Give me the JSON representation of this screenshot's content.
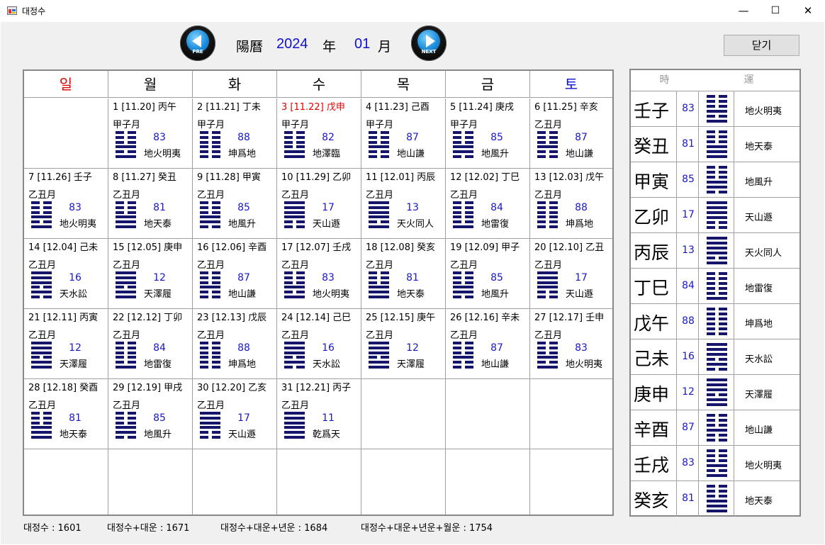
{
  "window": {
    "title": "대정수",
    "minimize": "—",
    "maximize": "☐",
    "close": "✕",
    "icon": "app-window-icon"
  },
  "nav": {
    "pre_caption": "PRE",
    "next_caption": "NEXT",
    "calendar_label": "陽曆",
    "year": "2024",
    "year_label": "年",
    "month": "01",
    "month_label": "月"
  },
  "close_button_label": "닫기",
  "colors": {
    "hex_bar": "#15156b",
    "number_blue": "#1818c8",
    "sunday": "#e00000",
    "saturday": "#1010d0"
  },
  "weekdays": [
    {
      "label": "일",
      "color": "#e00000"
    },
    {
      "label": "월",
      "color": "#000000"
    },
    {
      "label": "화",
      "color": "#000000"
    },
    {
      "label": "수",
      "color": "#000000"
    },
    {
      "label": "목",
      "color": "#000000"
    },
    {
      "label": "금",
      "color": "#000000"
    },
    {
      "label": "토",
      "color": "#1010d0"
    }
  ],
  "days": [
    {
      "col": 1,
      "row": 0,
      "header": "1 [11.20] 丙午",
      "month": "甲子月",
      "num": "83",
      "name": "地火明夷",
      "hex": "000101"
    },
    {
      "col": 2,
      "row": 0,
      "header": "2 [11.21] 丁未",
      "month": "甲子月",
      "num": "88",
      "name": "坤爲地",
      "hex": "000000"
    },
    {
      "col": 3,
      "row": 0,
      "header": "3 [11.22] 戊申",
      "month": "甲子月",
      "num": "82",
      "name": "地澤臨",
      "hex": "000011",
      "highlight": true
    },
    {
      "col": 4,
      "row": 0,
      "header": "4 [11.23] 己酉",
      "month": "甲子月",
      "num": "87",
      "name": "地山謙",
      "hex": "000100"
    },
    {
      "col": 5,
      "row": 0,
      "header": "5 [11.24] 庚戌",
      "month": "甲子月",
      "num": "85",
      "name": "地風升",
      "hex": "000110"
    },
    {
      "col": 6,
      "row": 0,
      "header": "6 [11.25] 辛亥",
      "month": "乙丑月",
      "num": "87",
      "name": "地山謙",
      "hex": "000100"
    },
    {
      "col": 0,
      "row": 1,
      "header": "7 [11.26] 壬子",
      "month": "乙丑月",
      "num": "83",
      "name": "地火明夷",
      "hex": "000101"
    },
    {
      "col": 1,
      "row": 1,
      "header": "8 [11.27] 癸丑",
      "month": "乙丑月",
      "num": "81",
      "name": "地天泰",
      "hex": "000111"
    },
    {
      "col": 2,
      "row": 1,
      "header": "9 [11.28] 甲寅",
      "month": "乙丑月",
      "num": "85",
      "name": "地風升",
      "hex": "000110"
    },
    {
      "col": 3,
      "row": 1,
      "header": "10 [11.29] 乙卯",
      "month": "乙丑月",
      "num": "17",
      "name": "天山遯",
      "hex": "111100"
    },
    {
      "col": 4,
      "row": 1,
      "header": "11 [12.01] 丙辰",
      "month": "乙丑月",
      "num": "13",
      "name": "天火同人",
      "hex": "111101"
    },
    {
      "col": 5,
      "row": 1,
      "header": "12 [12.02] 丁巳",
      "month": "乙丑月",
      "num": "84",
      "name": "地雷復",
      "hex": "000001"
    },
    {
      "col": 6,
      "row": 1,
      "header": "13 [12.03] 戊午",
      "month": "乙丑月",
      "num": "88",
      "name": "坤爲地",
      "hex": "000000"
    },
    {
      "col": 0,
      "row": 2,
      "header": "14 [12.04] 己未",
      "month": "乙丑月",
      "num": "16",
      "name": "天水訟",
      "hex": "111010"
    },
    {
      "col": 1,
      "row": 2,
      "header": "15 [12.05] 庚申",
      "month": "乙丑月",
      "num": "12",
      "name": "天澤履",
      "hex": "111011"
    },
    {
      "col": 2,
      "row": 2,
      "header": "16 [12.06] 辛酉",
      "month": "乙丑月",
      "num": "87",
      "name": "地山謙",
      "hex": "000100"
    },
    {
      "col": 3,
      "row": 2,
      "header": "17 [12.07] 壬戌",
      "month": "乙丑月",
      "num": "83",
      "name": "地火明夷",
      "hex": "000101"
    },
    {
      "col": 4,
      "row": 2,
      "header": "18 [12.08] 癸亥",
      "month": "乙丑月",
      "num": "81",
      "name": "地天泰",
      "hex": "000111"
    },
    {
      "col": 5,
      "row": 2,
      "header": "19 [12.09] 甲子",
      "month": "乙丑月",
      "num": "85",
      "name": "地風升",
      "hex": "000110"
    },
    {
      "col": 6,
      "row": 2,
      "header": "20 [12.10] 乙丑",
      "month": "乙丑月",
      "num": "17",
      "name": "天山遯",
      "hex": "111100"
    },
    {
      "col": 0,
      "row": 3,
      "header": "21 [12.11] 丙寅",
      "month": "乙丑月",
      "num": "12",
      "name": "天澤履",
      "hex": "111011"
    },
    {
      "col": 1,
      "row": 3,
      "header": "22 [12.12] 丁卯",
      "month": "乙丑月",
      "num": "84",
      "name": "地雷復",
      "hex": "000001"
    },
    {
      "col": 2,
      "row": 3,
      "header": "23 [12.13] 戊辰",
      "month": "乙丑月",
      "num": "88",
      "name": "坤爲地",
      "hex": "000000"
    },
    {
      "col": 3,
      "row": 3,
      "header": "24 [12.14] 己巳",
      "month": "乙丑月",
      "num": "16",
      "name": "天水訟",
      "hex": "111010"
    },
    {
      "col": 4,
      "row": 3,
      "header": "25 [12.15] 庚午",
      "month": "乙丑月",
      "num": "12",
      "name": "天澤履",
      "hex": "111011"
    },
    {
      "col": 5,
      "row": 3,
      "header": "26 [12.16] 辛未",
      "month": "乙丑月",
      "num": "87",
      "name": "地山謙",
      "hex": "000100"
    },
    {
      "col": 6,
      "row": 3,
      "header": "27 [12.17] 壬申",
      "month": "乙丑月",
      "num": "83",
      "name": "地火明夷",
      "hex": "000101"
    },
    {
      "col": 0,
      "row": 4,
      "header": "28 [12.18] 癸酉",
      "month": "乙丑月",
      "num": "81",
      "name": "地天泰",
      "hex": "000111"
    },
    {
      "col": 1,
      "row": 4,
      "header": "29 [12.19] 甲戌",
      "month": "乙丑月",
      "num": "85",
      "name": "地風升",
      "hex": "000110"
    },
    {
      "col": 2,
      "row": 4,
      "header": "30 [12.20] 乙亥",
      "month": "乙丑月",
      "num": "17",
      "name": "天山遯",
      "hex": "111100"
    },
    {
      "col": 3,
      "row": 4,
      "header": "31 [12.21] 丙子",
      "month": "乙丑月",
      "num": "11",
      "name": "乾爲天",
      "hex": "111111"
    }
  ],
  "side": {
    "col1_header": "時",
    "col2_header": "運",
    "rows": [
      {
        "gz": "壬子",
        "num": "83",
        "name": "地火明夷",
        "hex": "000101"
      },
      {
        "gz": "癸丑",
        "num": "81",
        "name": "地天泰",
        "hex": "000111"
      },
      {
        "gz": "甲寅",
        "num": "85",
        "name": "地風升",
        "hex": "000110"
      },
      {
        "gz": "乙卯",
        "num": "17",
        "name": "天山遯",
        "hex": "111100"
      },
      {
        "gz": "丙辰",
        "num": "13",
        "name": "天火同人",
        "hex": "111101"
      },
      {
        "gz": "丁巳",
        "num": "84",
        "name": "地雷復",
        "hex": "000001"
      },
      {
        "gz": "戊午",
        "num": "88",
        "name": "坤爲地",
        "hex": "000000"
      },
      {
        "gz": "己未",
        "num": "16",
        "name": "天水訟",
        "hex": "111010"
      },
      {
        "gz": "庚申",
        "num": "12",
        "name": "天澤履",
        "hex": "111011"
      },
      {
        "gz": "辛酉",
        "num": "87",
        "name": "地山謙",
        "hex": "000100"
      },
      {
        "gz": "壬戌",
        "num": "83",
        "name": "地火明夷",
        "hex": "000101"
      },
      {
        "gz": "癸亥",
        "num": "81",
        "name": "地天泰",
        "hex": "000111"
      }
    ]
  },
  "status": {
    "s1": "대정수 :  1601",
    "s2": "대정수+대운 :  1671",
    "s3": "대정수+대운+년운 :   1684",
    "s4": "대정수+대운+년운+월운 :  1754"
  }
}
